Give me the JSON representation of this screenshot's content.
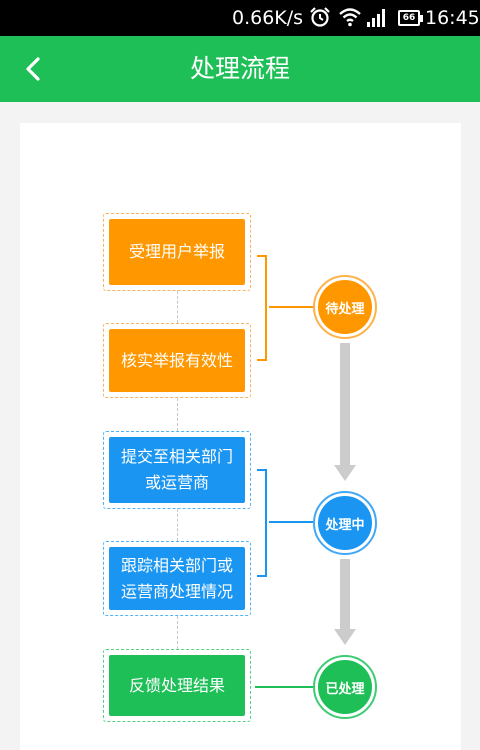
{
  "status_bar": {
    "network_speed": "0.66K/s",
    "battery": "66",
    "time": "16:45",
    "icons": [
      "alarm-icon",
      "wifi-icon",
      "signal-icon",
      "battery-icon"
    ]
  },
  "header": {
    "title": "处理流程",
    "back_icon": "chevron-left-icon",
    "background": "#1fbf58"
  },
  "flow": {
    "steps": [
      {
        "lines": [
          "受理用户举报"
        ],
        "color": "#ff9800"
      },
      {
        "lines": [
          "核实举报有效性"
        ],
        "color": "#ff9800"
      },
      {
        "lines": [
          "提交至相关部门",
          "或运营商"
        ],
        "color": "#1a96f2"
      },
      {
        "lines": [
          "跟踪相关部门或",
          "运营商处理情况"
        ],
        "color": "#1a96f2"
      },
      {
        "lines": [
          "反馈处理结果"
        ],
        "color": "#1fbf58"
      }
    ],
    "statuses": [
      {
        "label": "待处理",
        "color": "#ff9800"
      },
      {
        "label": "处理中",
        "color": "#1a96f2"
      },
      {
        "label": "已处理",
        "color": "#1fbf58"
      }
    ],
    "arrow_color": "#cccccc"
  }
}
